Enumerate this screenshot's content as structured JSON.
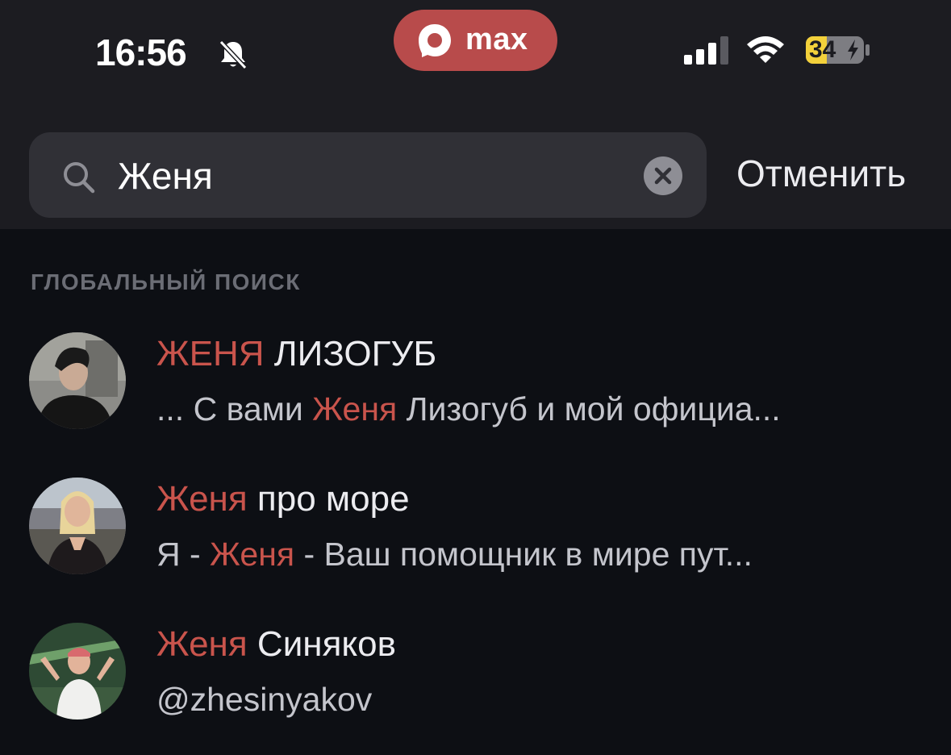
{
  "status_bar": {
    "time": "16:56",
    "app_badge": "max",
    "battery": "34"
  },
  "search": {
    "query": "Женя",
    "cancel_label": "Отменить"
  },
  "global_search": {
    "section_title": "ГЛОБАЛЬНЫЙ ПОИСК",
    "results": [
      {
        "name_highlight": "ЖЕНЯ",
        "name_rest": " ЛИЗОГУБ",
        "sub_before": "... С вами ",
        "sub_highlight": "Женя",
        "sub_after": " Лизогуб и мой официа..."
      },
      {
        "name_highlight": "Женя",
        "name_rest": " про море",
        "sub_before": "Я - ",
        "sub_highlight": "Женя",
        "sub_after": " - Ваш помощник в мире пут..."
      },
      {
        "name_highlight": "Женя",
        "name_rest": " Синяков",
        "sub_before": "@zhesinyakov",
        "sub_highlight": "",
        "sub_after": ""
      }
    ]
  },
  "colors": {
    "highlight": "#c9544c",
    "brand_pill": "#b84b4b",
    "background": "#0d0f14",
    "header": "#1c1c21"
  }
}
